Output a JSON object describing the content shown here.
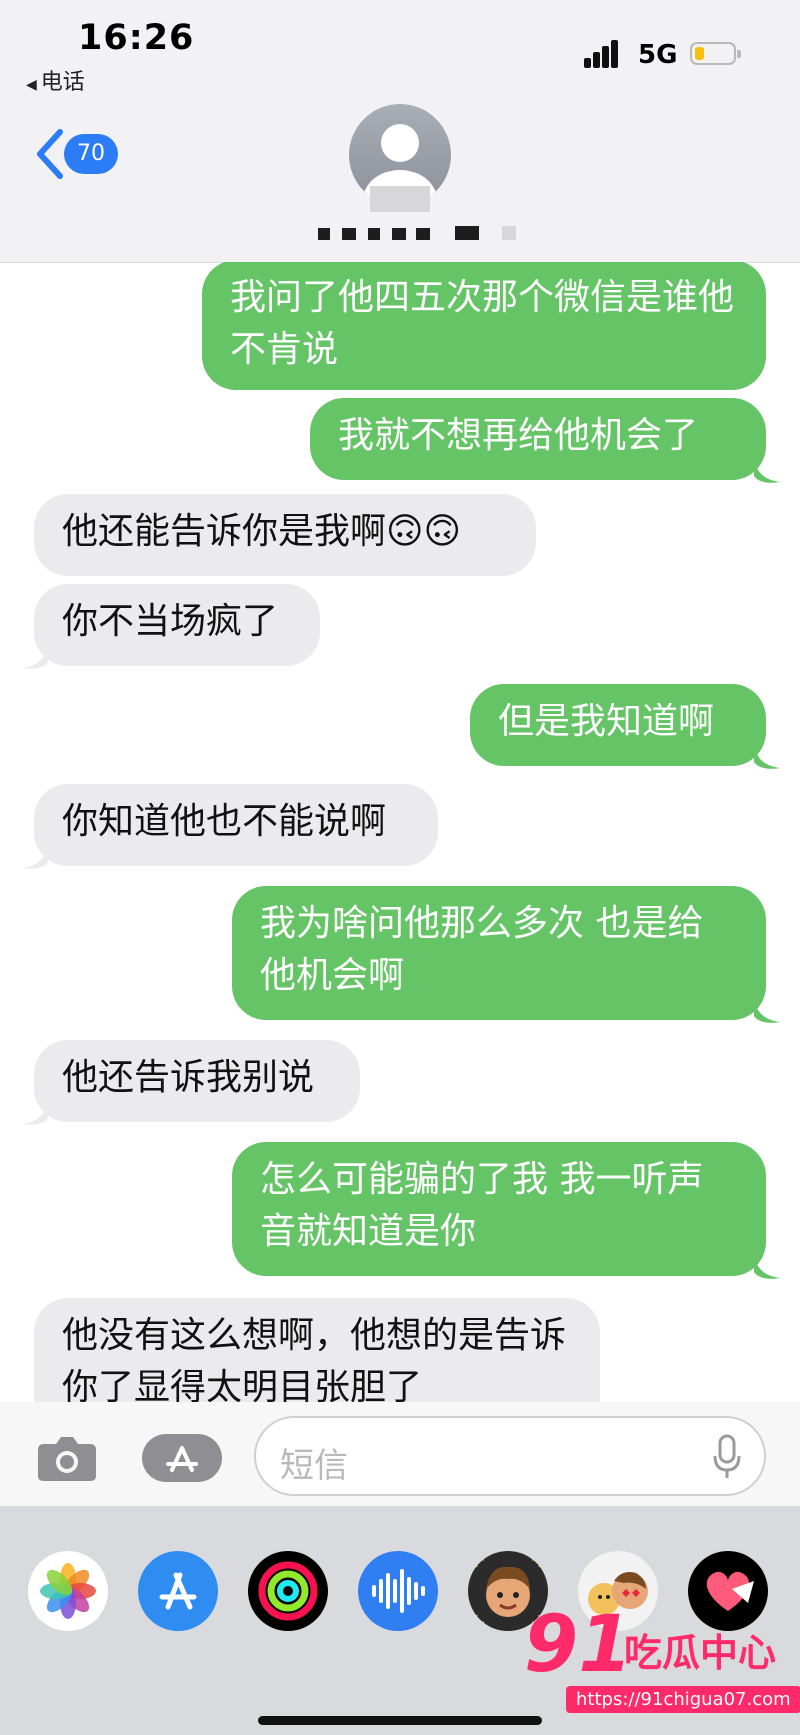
{
  "status_bar": {
    "time": "16:26",
    "back_app": "电话",
    "network": "5G"
  },
  "header": {
    "unread_count": "70"
  },
  "messages": [
    {
      "direction": "sent",
      "text": "我问了他四五次那个微信是谁他不肯说"
    },
    {
      "direction": "sent",
      "text": "我就不想再给他机会了"
    },
    {
      "direction": "received",
      "text": "他还能告诉你是我啊🙃🙃"
    },
    {
      "direction": "received",
      "text": "你不当场疯了"
    },
    {
      "direction": "sent",
      "text": "但是我知道啊"
    },
    {
      "direction": "received",
      "text": "你知道他也不能说啊"
    },
    {
      "direction": "sent",
      "text": "我为啥问他那么多次 也是给他机会啊"
    },
    {
      "direction": "received",
      "text": "他还告诉我别说"
    },
    {
      "direction": "sent",
      "text": "怎么可能骗的了我 我一听声音就知道是你"
    },
    {
      "direction": "received",
      "text": "他没有这么想啊，他想的是告诉你了显得太明目张胆了"
    }
  ],
  "input_bar": {
    "placeholder": "短信"
  },
  "app_drawer": [
    "photos-app",
    "app-store-app",
    "fitness-app",
    "audio-message-app",
    "memoji-app",
    "memoji-stickers-app",
    "digital-touch-app"
  ],
  "watermark": {
    "number": "91",
    "name": "吃瓜中心",
    "url": "https://91chigua07.com"
  },
  "colors": {
    "sent_bubble": "#65c466",
    "received_bubble": "#ebebed",
    "badge": "#2b7cf6",
    "watermark": "#ff2a6a"
  }
}
